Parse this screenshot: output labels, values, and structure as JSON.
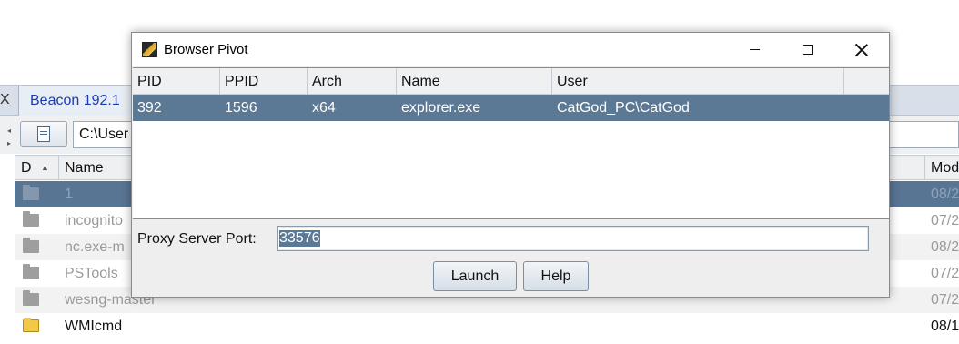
{
  "background_app": {
    "tab_close": "X",
    "tab_label": "Beacon 192.1",
    "path_value": "C:\\User",
    "headers": {
      "d": "D",
      "name": "Name",
      "modified": "Mod"
    },
    "rows": [
      {
        "name": "1",
        "date": "08/2",
        "state": "selected",
        "icon": "folder-icon"
      },
      {
        "name": "incognito",
        "date": "07/2",
        "state": "normal",
        "icon": "folder-icon"
      },
      {
        "name": "nc.exe-m",
        "date": "08/2",
        "state": "normal",
        "icon": "folder-icon"
      },
      {
        "name": "PSTools",
        "date": "07/2",
        "state": "normal",
        "icon": "folder-icon"
      },
      {
        "name": "wesng-master",
        "date": "07/2",
        "state": "normal",
        "icon": "folder-icon"
      },
      {
        "name": "WMIcmd",
        "date": "08/1",
        "state": "normal",
        "icon": "yellow-folder-icon"
      }
    ]
  },
  "dialog": {
    "title": "Browser Pivot",
    "columns": {
      "pid": "PID",
      "ppid": "PPID",
      "arch": "Arch",
      "name": "Name",
      "user": "User"
    },
    "rows": [
      {
        "pid": "392",
        "ppid": "1596",
        "arch": "x64",
        "name": "explorer.exe",
        "user": "CatGod_PC\\CatGod"
      }
    ],
    "proxy_label": "Proxy Server Port:",
    "proxy_port": "33576",
    "launch_label": "Launch",
    "help_label": "Help"
  },
  "colors": {
    "selection": "#5b7895",
    "tab_text": "#1a3bb5"
  }
}
